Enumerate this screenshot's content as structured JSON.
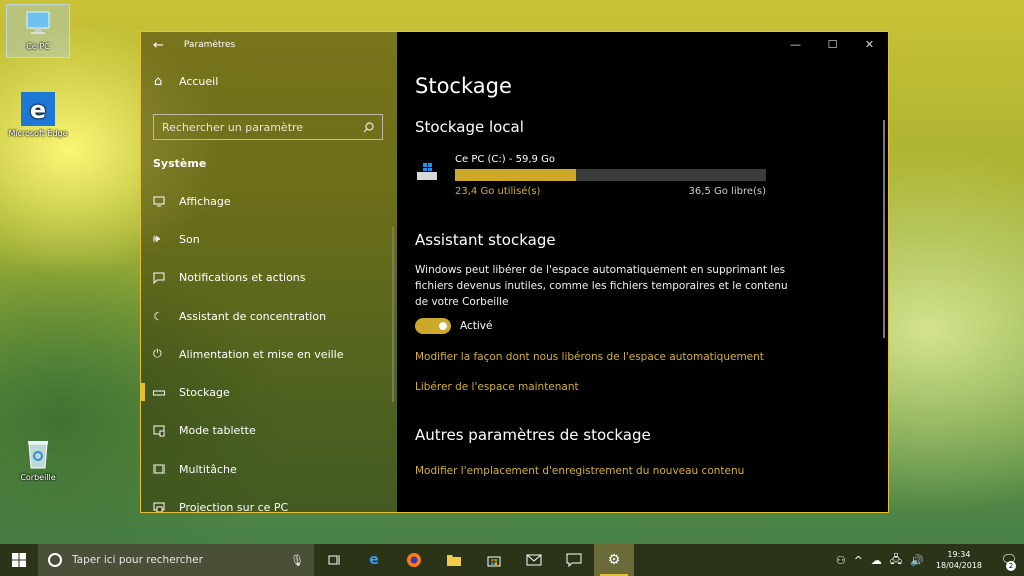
{
  "desktop": {
    "icons": [
      {
        "label": "Ce PC"
      },
      {
        "label": "Microsoft Edge"
      },
      {
        "label": "Corbeille"
      }
    ]
  },
  "window": {
    "app_title": "Paramètres",
    "controls": {
      "minimize": "—",
      "maximize": "☐",
      "close": "✕"
    }
  },
  "sidebar": {
    "home_label": "Accueil",
    "search_placeholder": "Rechercher un paramètre",
    "section_title": "Système",
    "items": [
      {
        "label": "Affichage",
        "icon": "monitor-icon"
      },
      {
        "label": "Son",
        "icon": "speaker-icon"
      },
      {
        "label": "Notifications et actions",
        "icon": "message-icon"
      },
      {
        "label": "Assistant de concentration",
        "icon": "moon-icon"
      },
      {
        "label": "Alimentation et mise en veille",
        "icon": "power-icon"
      },
      {
        "label": "Stockage",
        "icon": "drive-icon",
        "active": true
      },
      {
        "label": "Mode tablette",
        "icon": "tablet-icon"
      },
      {
        "label": "Multitâche",
        "icon": "multitask-icon"
      },
      {
        "label": "Projection sur ce PC",
        "icon": "projection-icon"
      }
    ]
  },
  "content": {
    "page_title": "Stockage",
    "local_storage": {
      "heading": "Stockage local",
      "drive_name": "Ce PC (C:) - 59,9 Go",
      "used_label": "23,4 Go utilisé(s)",
      "free_label": "36,5 Go libre(s)",
      "used_fraction": 0.39
    },
    "storage_sense": {
      "heading": "Assistant stockage",
      "description": "Windows peut libérer de l'espace automatiquement en supprimant les fichiers devenus inutiles, comme les fichiers temporaires et le contenu de votre Corbeille",
      "toggle_state": "Activé",
      "link_change": "Modifier la façon dont nous libérons de l'espace automatiquement",
      "link_free_now": "Libérer de l'espace maintenant"
    },
    "other": {
      "heading": "Autres paramètres de stockage",
      "link_change_location": "Modifier l'emplacement d'enregistrement du nouveau contenu"
    }
  },
  "taskbar": {
    "search_placeholder": "Taper ici pour rechercher",
    "time": "19:34",
    "date": "18/04/2018",
    "notification_count": "2"
  },
  "colors": {
    "accent": "#cea82b",
    "link": "#d4b035",
    "content_bg": "#000000"
  }
}
